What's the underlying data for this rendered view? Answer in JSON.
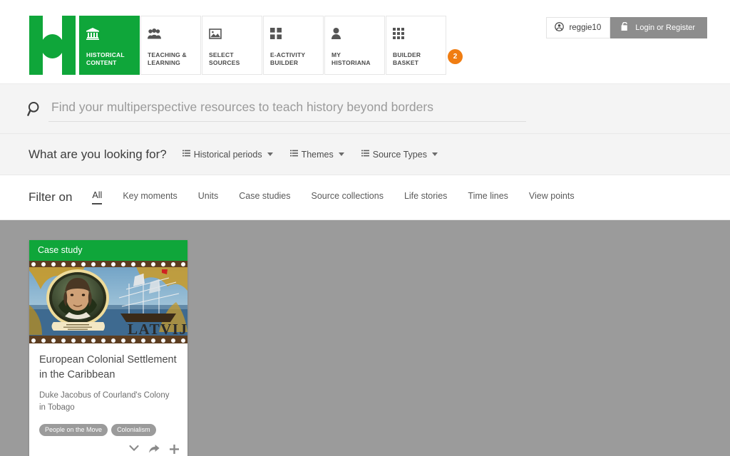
{
  "colors": {
    "brand_green": "#0fa63a",
    "badge_orange": "#f07d12",
    "content_gray": "#9b9b9b",
    "button_gray": "#8d8d8d"
  },
  "header": {
    "logo_alt": "historiana-logo",
    "nav_items": [
      {
        "label": "HISTORICAL\nCONTENT",
        "line1": "HISTORICAL",
        "line2": "CONTENT",
        "icon": "bank-icon",
        "active": true
      },
      {
        "label": "TEACHING &\nLEARNING",
        "line1": "TEACHING &",
        "line2": "LEARNING",
        "icon": "people-group-icon",
        "active": false
      },
      {
        "label": "SELECT\nSOURCES",
        "line1": "SELECT",
        "line2": "SOURCES",
        "icon": "picture-icon",
        "active": false
      },
      {
        "label": "E-ACTIVITY\nBUILDER",
        "line1": "E-ACTIVITY",
        "line2": "BUILDER",
        "icon": "grid-2x2-icon",
        "active": false
      },
      {
        "label": "MY\nHISTORIANA",
        "line1": "MY",
        "line2": "HISTORIANA",
        "icon": "person-icon",
        "active": false
      },
      {
        "label": "BUILDER\nBASKET",
        "line1": "BUILDER",
        "line2": "BASKET",
        "icon": "grid-3x3-icon",
        "active": false,
        "badge": "2"
      }
    ],
    "user": {
      "name": "reggie10",
      "user_icon": "user-circle-icon",
      "login_label": "Login or Register",
      "login_icon": "unlock-padlock-icon"
    }
  },
  "search": {
    "icon": "search-icon",
    "value": "",
    "placeholder": "Find your multiperspective resources to teach history beyond borders"
  },
  "lookfor": {
    "title": "What are you looking for?",
    "dropdowns": [
      {
        "label": "Historical periods",
        "icon": "list-icon"
      },
      {
        "label": "Themes",
        "icon": "list-icon"
      },
      {
        "label": "Source Types",
        "icon": "list-icon"
      }
    ]
  },
  "filter": {
    "title": "Filter on",
    "tabs": [
      {
        "label": "All",
        "active": true
      },
      {
        "label": "Key moments",
        "active": false
      },
      {
        "label": "Units",
        "active": false
      },
      {
        "label": "Case studies",
        "active": false
      },
      {
        "label": "Source collections",
        "active": false
      },
      {
        "label": "Life stories",
        "active": false
      },
      {
        "label": "Time lines",
        "active": false
      },
      {
        "label": "View points",
        "active": false
      }
    ]
  },
  "results": {
    "cards": [
      {
        "type_label": "Case study",
        "image_alt": "latvia-postage-stamp-duke-jacobus-and-sailing-ship",
        "image_caption": "LATVIJA",
        "title": "European Colonial Settlement in the Caribbean",
        "subtitle": "Duke Jacobus of Courland's Colony in Tobago",
        "tags": [
          "People on the Move",
          "Colonialism"
        ],
        "actions": [
          {
            "icon": "chevron-down-icon",
            "name": "expand"
          },
          {
            "icon": "share-arrow-icon",
            "name": "share"
          },
          {
            "icon": "plus-icon",
            "name": "add-to-basket"
          }
        ]
      }
    ]
  }
}
